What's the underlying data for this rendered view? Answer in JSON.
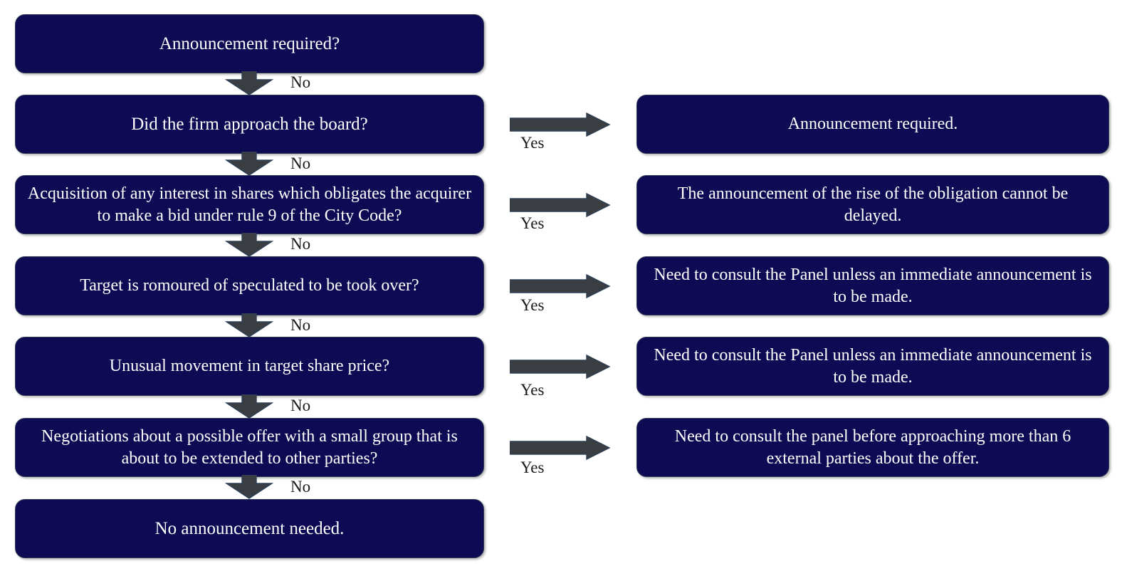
{
  "diagram": {
    "title": "Announcement required? decision flowchart",
    "colors": {
      "node_fill": "#0E0A54",
      "node_border": "#2E3A55",
      "node_text": "#FFFFFF",
      "arrow_fill": "#3A3D42",
      "arrow_border": "#2E4057",
      "label_text": "#1A1A1A",
      "background": "#FFFFFF"
    },
    "decisions": [
      {
        "id": "d1",
        "text": "Announcement required?"
      },
      {
        "id": "d2",
        "text": "Did the firm approach the board?"
      },
      {
        "id": "d3",
        "text": "Acquisition of any interest in shares which obligates the acquirer to make a bid under rule 9 of the City Code?"
      },
      {
        "id": "d4",
        "text": "Target is romoured of speculated to be took over?"
      },
      {
        "id": "d5",
        "text": "Unusual movement in target share price?"
      },
      {
        "id": "d6",
        "text": "Negotiations about a possible offer with a small group that is about to be extended to other parties?"
      },
      {
        "id": "d7",
        "text": "No announcement needed."
      }
    ],
    "outcomes": [
      {
        "id": "o1",
        "text": "Announcement required."
      },
      {
        "id": "o2",
        "text": "The announcement of the rise of the obligation cannot be delayed."
      },
      {
        "id": "o3",
        "text": "Need to consult the Panel unless an immediate announcement is to be made."
      },
      {
        "id": "o4",
        "text": "Need to consult the Panel unless an immediate announcement is to be made."
      },
      {
        "id": "o5",
        "text": "Need to consult the panel before approaching more than 6 external parties about the offer."
      }
    ],
    "no_labels": [
      {
        "id": "no1",
        "text": "No"
      },
      {
        "id": "no2",
        "text": "No"
      },
      {
        "id": "no3",
        "text": "No"
      },
      {
        "id": "no4",
        "text": "No"
      },
      {
        "id": "no5",
        "text": "No"
      },
      {
        "id": "no6",
        "text": "No"
      }
    ],
    "yes_labels": [
      {
        "id": "yes1",
        "text": "Yes"
      },
      {
        "id": "yes2",
        "text": "Yes"
      },
      {
        "id": "yes3",
        "text": "Yes"
      },
      {
        "id": "yes4",
        "text": "Yes"
      },
      {
        "id": "yes5",
        "text": "Yes"
      }
    ]
  }
}
